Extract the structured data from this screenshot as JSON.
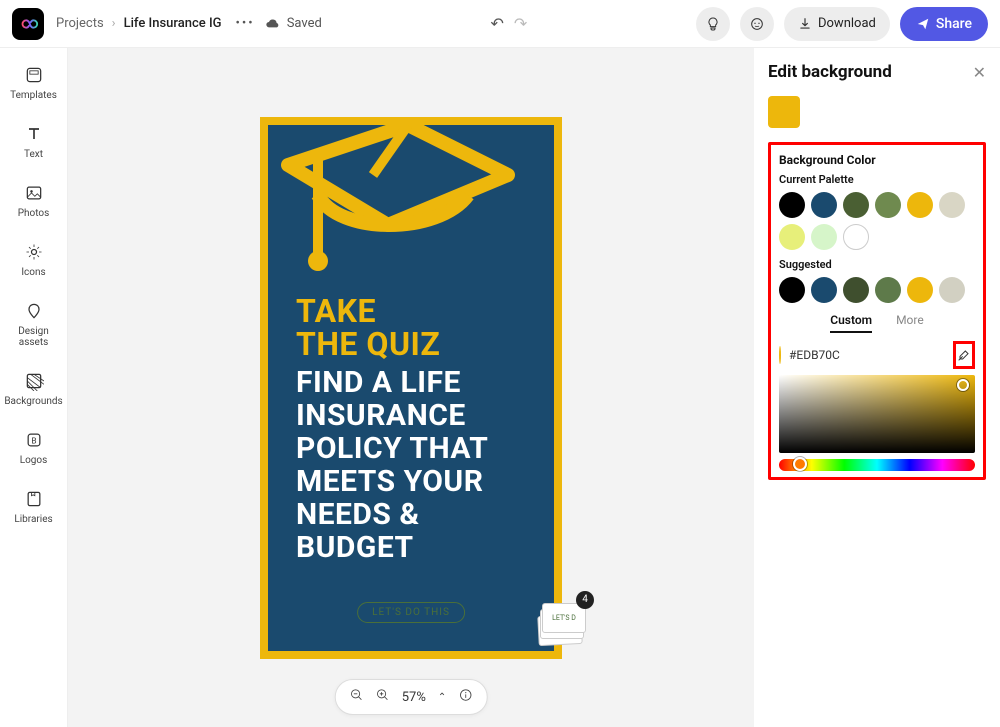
{
  "header": {
    "projects_label": "Projects",
    "project_name": "Life Insurance IG",
    "saved_label": "Saved",
    "download_label": "Download",
    "share_label": "Share"
  },
  "leftnav": {
    "templates": "Templates",
    "text": "Text",
    "photos": "Photos",
    "icons": "Icons",
    "design_assets": "Design assets",
    "backgrounds": "Backgrounds",
    "logos": "Logos",
    "libraries": "Libraries"
  },
  "canvas": {
    "bg_color": "#EDB70C",
    "inner_color": "#1a4a6e",
    "text_yellow_1": "TAKE",
    "text_yellow_2": "THE QUIZ",
    "text_white": "FIND A LIFE INSURANCE POLICY THAT MEETS YOUR NEEDS & BUDGET",
    "badge": "LET'S DO THIS",
    "page_count": "4"
  },
  "zoom": {
    "value": "57%"
  },
  "rightpanel": {
    "title": "Edit background",
    "section_title": "Background Color",
    "current_palette_label": "Current Palette",
    "suggested_label": "Suggested",
    "tab_custom": "Custom",
    "tab_more": "More",
    "hex_value": "#EDB70C",
    "current_palette": [
      "#000000",
      "#1a4a6e",
      "#4a5f33",
      "#6f8a4f",
      "#EDB70C",
      "#d9d6c5",
      "#e7ef7a",
      "#d6f5c9",
      "#ffffff"
    ],
    "suggested": [
      "#000000",
      "#1a4a6e",
      "#3f4f2e",
      "#5e7a4a",
      "#EDB70C",
      "#d2d0c2"
    ]
  }
}
